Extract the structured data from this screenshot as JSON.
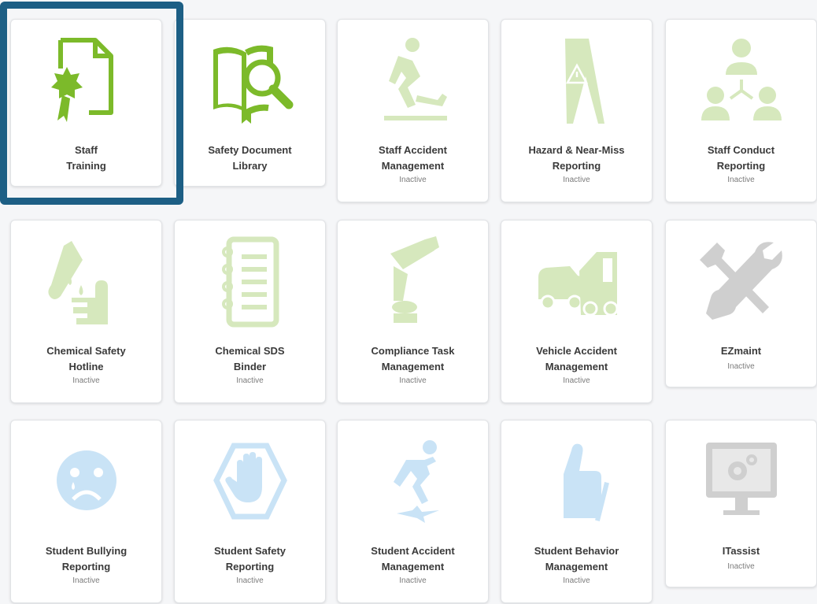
{
  "tiles": [
    {
      "line1": "Staff",
      "line2": "Training",
      "status": "",
      "icon": "certificate-icon",
      "color": "#7cba2a"
    },
    {
      "line1": "Safety Document",
      "line2": "Library",
      "status": "",
      "icon": "book-magnifier-icon",
      "color": "#7cba2a"
    },
    {
      "line1": "Staff Accident",
      "line2": "Management",
      "status": "Inactive",
      "icon": "slip-fall-icon",
      "color": "#d6e8bd"
    },
    {
      "line1": "Hazard & Near-Miss",
      "line2": "Reporting",
      "status": "Inactive",
      "icon": "wet-floor-sign-icon",
      "color": "#d6e8bd"
    },
    {
      "line1": "Staff Conduct",
      "line2": "Reporting",
      "status": "Inactive",
      "icon": "org-chart-icon",
      "color": "#d6e8bd"
    },
    {
      "line1": "Chemical Safety",
      "line2": "Hotline",
      "status": "Inactive",
      "icon": "chemical-hand-icon",
      "color": "#d6e8bd"
    },
    {
      "line1": "Chemical SDS",
      "line2": "Binder",
      "status": "Inactive",
      "icon": "notebook-icon",
      "color": "#d6e8bd"
    },
    {
      "line1": "Compliance Task",
      "line2": "Management",
      "status": "Inactive",
      "icon": "robot-arm-icon",
      "color": "#d6e8bd"
    },
    {
      "line1": "Vehicle Accident",
      "line2": "Management",
      "status": "Inactive",
      "icon": "car-crash-icon",
      "color": "#d6e8bd"
    },
    {
      "line1": "EZmaint",
      "line2": "",
      "status": "Inactive",
      "icon": "tools-icon",
      "color": "#cfcfcf"
    },
    {
      "line1": "Student Bullying",
      "line2": "Reporting",
      "status": "Inactive",
      "icon": "sad-face-icon",
      "color": "#c9e3f6"
    },
    {
      "line1": "Student Safety",
      "line2": "Reporting",
      "status": "Inactive",
      "icon": "stop-hand-icon",
      "color": "#c9e3f6"
    },
    {
      "line1": "Student Accident",
      "line2": "Management",
      "status": "Inactive",
      "icon": "falling-person-icon",
      "color": "#c9e3f6"
    },
    {
      "line1": "Student Behavior",
      "line2": "Management",
      "status": "Inactive",
      "icon": "thumbs-up-icon",
      "color": "#c9e3f6"
    },
    {
      "line1": "ITassist",
      "line2": "",
      "status": "Inactive",
      "icon": "computer-gears-icon",
      "color": "#cfcfcf"
    }
  ],
  "focus_color": "#1d5f85"
}
